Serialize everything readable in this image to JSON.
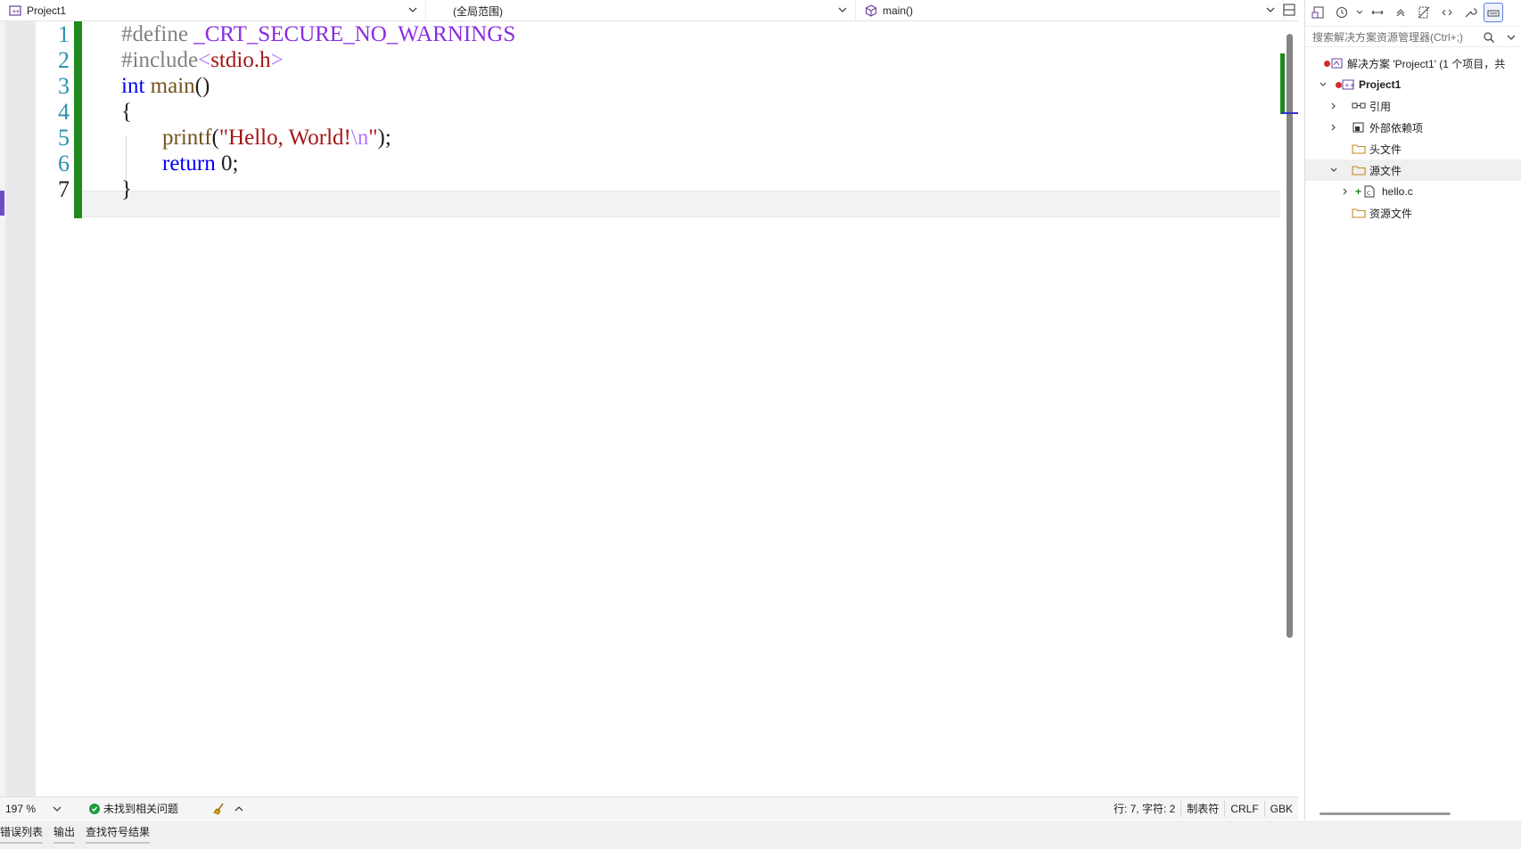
{
  "editor": {
    "nav": {
      "project": "Project1",
      "scope": "(全局范围)",
      "member": "main()"
    },
    "line_numbers": [
      "1",
      "2",
      "3",
      "4",
      "5",
      "6",
      "7"
    ],
    "active_line": 7,
    "code": {
      "l1_directive": "#define",
      "l1_macro": " _CRT_SECURE_NO_WARNINGS",
      "l2_directive": "#include",
      "l2_open": "<",
      "l2_header": "stdio.h",
      "l2_close": ">",
      "l3_type": "int",
      "l3_func": " main",
      "l3_parens": "()",
      "l4_brace": "{",
      "l5_func": "printf",
      "l5_open": "(",
      "l5_str": "\"Hello, World!",
      "l5_esc": "\\n",
      "l5_strend": "\"",
      "l5_close": ");",
      "l6_kw": "return",
      "l6_num": " 0",
      "l6_semi": ";",
      "l7_brace": "}"
    },
    "status": {
      "zoom": "197 %",
      "issues": "未找到相关问题",
      "position": "行: 7, 字符: 2",
      "tabs": "制表符",
      "line_ending": "CRLF",
      "encoding": "GBK"
    }
  },
  "bottom_tabs": [
    "错误列表",
    "输出",
    "查找符号结果"
  ],
  "solution_explorer": {
    "search_placeholder": "搜索解决方案资源管理器(Ctrl+;)",
    "solution_label": "解决方案 'Project1' (1 个项目，共",
    "project_label": "Project1",
    "nodes": {
      "references": "引用",
      "external_deps": "外部依赖项",
      "header_files": "头文件",
      "source_files": "源文件",
      "hello_c": "hello.c",
      "resource_files": "资源文件"
    }
  },
  "colors": {
    "change_bar": "#1e8a1e",
    "caret_marker": "#6a4fc9",
    "keyword": "#0000ff",
    "string": "#a31515",
    "macro": "#8a2be2",
    "line_number": "#2b91af"
  }
}
